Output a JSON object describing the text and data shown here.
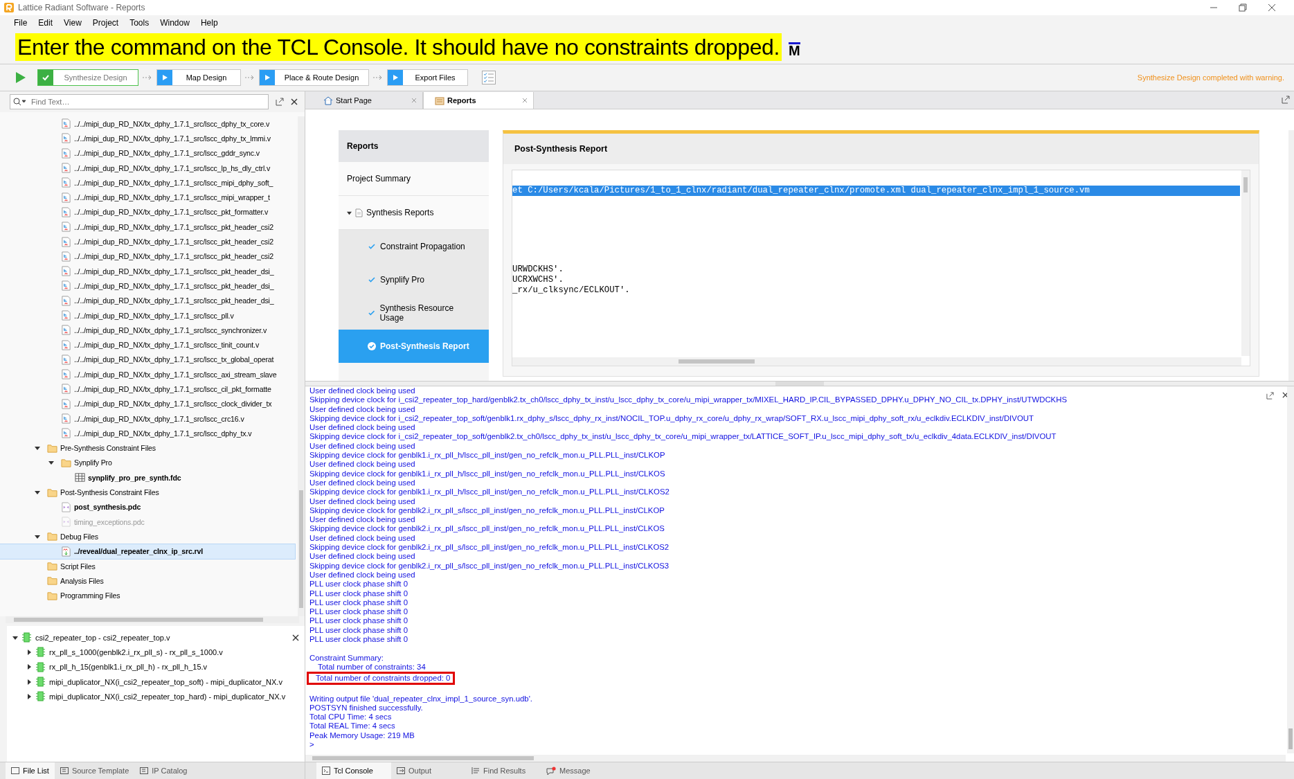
{
  "window": {
    "title": "Lattice Radiant Software - Reports"
  },
  "menu": [
    "File",
    "Edit",
    "View",
    "Project",
    "Tools",
    "Window",
    "Help"
  ],
  "banner": {
    "text": "Enter the command on the TCL Console. It should have no constraints dropped.",
    "mark": "M"
  },
  "toolbar": {
    "steps": [
      {
        "label": "Synthesize Design",
        "done": true
      },
      {
        "label": "Map Design",
        "done": false
      },
      {
        "label": "Place & Route Design",
        "done": false
      },
      {
        "label": "Export Files",
        "done": false
      }
    ],
    "status": "Synthesize Design completed with warning."
  },
  "search": {
    "placeholder": "Find Text…"
  },
  "file_tree": {
    "continued_children": [
      {
        "label": "../../mipi_dup_RD_NX/tx_dphy_1.7.1_src/lscc_dphy_tx_core.v",
        "selected": false
      },
      {
        "label": "../../mipi_dup_RD_NX/tx_dphy_1.7.1_src/lscc_dphy_tx_lmmi.v",
        "selected": false
      },
      {
        "label": "../../mipi_dup_RD_NX/tx_dphy_1.7.1_src/lscc_gddr_sync.v",
        "selected": false
      },
      {
        "label": "../../mipi_dup_RD_NX/tx_dphy_1.7.1_src/lscc_lp_hs_dly_ctrl.v",
        "selected": false
      },
      {
        "label": "../../mipi_dup_RD_NX/tx_dphy_1.7.1_src/lscc_mipi_dphy_soft_",
        "selected": false
      },
      {
        "label": "../../mipi_dup_RD_NX/tx_dphy_1.7.1_src/lscc_mipi_wrapper_t",
        "selected": false
      },
      {
        "label": "../../mipi_dup_RD_NX/tx_dphy_1.7.1_src/lscc_pkt_formatter.v",
        "selected": false
      },
      {
        "label": "../../mipi_dup_RD_NX/tx_dphy_1.7.1_src/lscc_pkt_header_csi2",
        "selected": false
      },
      {
        "label": "../../mipi_dup_RD_NX/tx_dphy_1.7.1_src/lscc_pkt_header_csi2",
        "selected": false
      },
      {
        "label": "../../mipi_dup_RD_NX/tx_dphy_1.7.1_src/lscc_pkt_header_csi2",
        "selected": false
      },
      {
        "label": "../../mipi_dup_RD_NX/tx_dphy_1.7.1_src/lscc_pkt_header_dsi_",
        "selected": false
      },
      {
        "label": "../../mipi_dup_RD_NX/tx_dphy_1.7.1_src/lscc_pkt_header_dsi_",
        "selected": false
      },
      {
        "label": "../../mipi_dup_RD_NX/tx_dphy_1.7.1_src/lscc_pkt_header_dsi_",
        "selected": false
      },
      {
        "label": "../../mipi_dup_RD_NX/tx_dphy_1.7.1_src/lscc_pll.v",
        "selected": false
      },
      {
        "label": "../../mipi_dup_RD_NX/tx_dphy_1.7.1_src/lscc_synchronizer.v",
        "selected": false
      },
      {
        "label": "../../mipi_dup_RD_NX/tx_dphy_1.7.1_src/lscc_tinit_count.v",
        "selected": false
      },
      {
        "label": "../../mipi_dup_RD_NX/tx_dphy_1.7.1_src/lscc_tx_global_operat",
        "selected": false
      },
      {
        "label": "../../mipi_dup_RD_NX/tx_dphy_1.7.1_src/lscc_axi_stream_slave",
        "selected": false
      },
      {
        "label": "../../mipi_dup_RD_NX/tx_dphy_1.7.1_src/lscc_cil_pkt_formatte",
        "selected": false
      },
      {
        "label": "../../mipi_dup_RD_NX/tx_dphy_1.7.1_src/lscc_clock_divider_tx",
        "selected": false
      },
      {
        "label": "../../mipi_dup_RD_NX/tx_dphy_1.7.1_src/lscc_crc16.v",
        "selected": false
      },
      {
        "label": "../../mipi_dup_RD_NX/tx_dphy_1.7.1_src/lscc_dphy_tx.v",
        "selected": false
      }
    ],
    "nodes": [
      {
        "kind": "folder",
        "label": "Pre-Synthesis Constraint Files",
        "expanded": true,
        "selected": false,
        "children": [
          {
            "kind": "folder",
            "label": "Synplify Pro",
            "expanded": true,
            "selected": false,
            "children": [
              {
                "kind": "table",
                "label": "synplify_pro_pre_synth.fdc",
                "active": true,
                "disabled": false,
                "selected": false
              }
            ]
          }
        ]
      },
      {
        "kind": "folder",
        "label": "Post-Synthesis Constraint Files",
        "expanded": true,
        "selected": false,
        "children": [
          {
            "kind": "constraint",
            "label": "post_synthesis.pdc",
            "active": true,
            "disabled": false,
            "selected": false
          },
          {
            "kind": "constraint",
            "label": "timing_exceptions.pdc",
            "active": false,
            "disabled": true,
            "selected": false
          }
        ]
      },
      {
        "kind": "folder",
        "label": "Debug Files",
        "expanded": true,
        "selected": false,
        "children": [
          {
            "kind": "debug",
            "label": "../reveal/dual_repeater_clnx_ip_src.rvl",
            "active": true,
            "disabled": false,
            "selected": true
          }
        ]
      },
      {
        "kind": "folder",
        "label": "Script Files",
        "selected": false
      },
      {
        "kind": "folder",
        "label": "Analysis Files",
        "selected": false
      },
      {
        "kind": "folder",
        "label": "Programming Files",
        "selected": false
      }
    ]
  },
  "hierarchy": {
    "root": {
      "label": "csi2_repeater_top - csi2_repeater_top.v",
      "expanded": true
    },
    "children": [
      {
        "label": "rx_pll_s_1000(genblk2.i_rx_pll_s) - rx_pll_s_1000.v",
        "expanded": false
      },
      {
        "label": "rx_pll_h_15(genblk1.i_rx_pll_h) - rx_pll_h_15.v",
        "expanded": false
      },
      {
        "label": "mipi_duplicator_NX(i_csi2_repeater_top_soft) - mipi_duplicator_NX.v",
        "expanded": false
      },
      {
        "label": "mipi_duplicator_NX(i_csi2_repeater_top_hard) - mipi_duplicator_NX.v",
        "expanded": false
      }
    ]
  },
  "left_tabs": [
    {
      "label": "File List",
      "selected": true
    },
    {
      "label": "Source Template",
      "selected": false
    },
    {
      "label": "IP Catalog",
      "selected": false
    }
  ],
  "doc_tabs": [
    {
      "label": "Start Page",
      "kind": "home",
      "selected": false
    },
    {
      "label": "Reports",
      "kind": "report",
      "selected": true
    }
  ],
  "reports": {
    "title": "Reports",
    "items": [
      {
        "kind": "item",
        "label": "Project Summary",
        "selected": false
      },
      {
        "kind": "group",
        "label": "Synthesis Reports",
        "expanded": true,
        "selected": false,
        "children": [
          {
            "label": "Constraint Propagation",
            "selected": false
          },
          {
            "label": "Synplify Pro",
            "selected": false
          },
          {
            "label": "Synthesis Resource Usage",
            "selected": false
          },
          {
            "label": "Post-Synthesis Report",
            "selected": true
          }
        ]
      }
    ],
    "panel": {
      "title": "Post-Synthesis Report",
      "lines": [
        {
          "text": "et C:/Users/kcala/Pictures/1_to_1_clnx/radiant/dual_repeater_clnx/promote.xml dual_repeater_clnx_impl_1_source.vm",
          "selected": true
        },
        {
          "text": "URWDCKHS'.",
          "selected": false
        },
        {
          "text": "UCRXWCHS'.",
          "selected": false
        },
        {
          "text": "_rx/u_clksync/ECLKOUT'.",
          "selected": false
        }
      ]
    }
  },
  "console": {
    "blocks": [
      {
        "kind": "plain",
        "lines": [
          "User defined clock being used",
          "Skipping device clock for i_csi2_repeater_top_hard/genblk2.tx_ch0/lscc_dphy_tx_inst/u_lscc_dphy_tx_core/u_mipi_wrapper_tx/MIXEL_HARD_IP.CIL_BYPASSED_DPHY.u_DPHY_NO_CIL_tx.DPHY_inst/UTWDCKHS",
          "User defined clock being used",
          "Skipping device clock for i_csi2_repeater_top_soft/genblk1.rx_dphy_s/lscc_dphy_rx_inst/NOCIL_TOP.u_dphy_rx_core/u_dphy_rx_wrap/SOFT_RX.u_lscc_mipi_dphy_soft_rx/u_eclkdiv.ECLKDIV_inst/DIVOUT",
          "User defined clock being used",
          "Skipping device clock for i_csi2_repeater_top_soft/genblk2.tx_ch0/lscc_dphy_tx_inst/u_lscc_dphy_tx_core/u_mipi_wrapper_tx/LATTICE_SOFT_IP.u_lscc_mipi_dphy_soft_tx/u_eclkdiv_4data.ECLKDIV_inst/DIVOUT",
          "User defined clock being used",
          "Skipping device clock for genblk1.i_rx_pll_h/lscc_pll_inst/gen_no_refclk_mon.u_PLL.PLL_inst/CLKOP",
          "User defined clock being used",
          "Skipping device clock for genblk1.i_rx_pll_h/lscc_pll_inst/gen_no_refclk_mon.u_PLL.PLL_inst/CLKOS",
          "User defined clock being used",
          "Skipping device clock for genblk1.i_rx_pll_h/lscc_pll_inst/gen_no_refclk_mon.u_PLL.PLL_inst/CLKOS2",
          "User defined clock being used",
          "Skipping device clock for genblk2.i_rx_pll_s/lscc_pll_inst/gen_no_refclk_mon.u_PLL.PLL_inst/CLKOP",
          "User defined clock being used",
          "Skipping device clock for genblk2.i_rx_pll_s/lscc_pll_inst/gen_no_refclk_mon.u_PLL.PLL_inst/CLKOS",
          "User defined clock being used",
          "Skipping device clock for genblk2.i_rx_pll_s/lscc_pll_inst/gen_no_refclk_mon.u_PLL.PLL_inst/CLKOS2",
          "User defined clock being used",
          "Skipping device clock for genblk2.i_rx_pll_s/lscc_pll_inst/gen_no_refclk_mon.u_PLL.PLL_inst/CLKOS3",
          "User defined clock being used",
          "PLL user clock phase shift 0",
          "PLL user clock phase shift 0",
          "PLL user clock phase shift 0",
          "PLL user clock phase shift 0",
          "PLL user clock phase shift 0",
          "PLL user clock phase shift 0",
          "PLL user clock phase shift 0"
        ]
      },
      {
        "kind": "summary",
        "title": "Constraint Summary:",
        "items": [
          "Total number of constraints: 34"
        ],
        "boxed_item": "Total number of constraints dropped: 0"
      },
      {
        "kind": "plain",
        "lines": [
          "Writing output file 'dual_repeater_clnx_impl_1_source_syn.udb'.",
          "POSTSYN finished successfully.",
          "Total CPU Time: 4 secs",
          "Total REAL Time: 4 secs",
          "Peak Memory Usage: 219 MB"
        ]
      }
    ],
    "prompt": ">"
  },
  "console_tabs": [
    {
      "label": "Tcl Console",
      "kind": "console",
      "selected": true
    },
    {
      "label": "Output",
      "kind": "output",
      "selected": false
    },
    {
      "label": "Find Results",
      "kind": "find",
      "selected": false
    },
    {
      "label": "Message",
      "kind": "message",
      "selected": false
    }
  ]
}
